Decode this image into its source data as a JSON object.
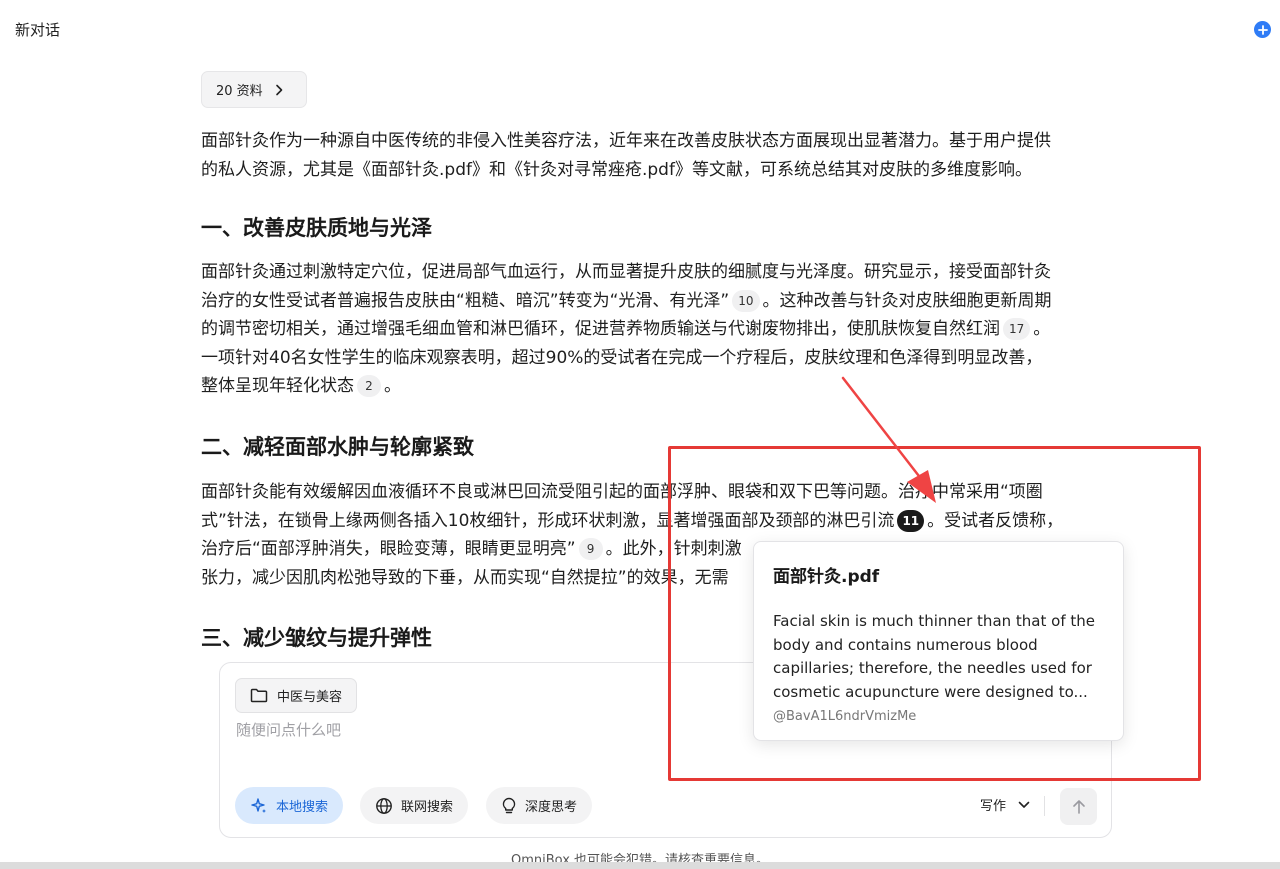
{
  "header": {
    "title": "新对话"
  },
  "sources": {
    "label": "20 资料"
  },
  "article": {
    "intro_l1": "面部针灸作为一种源自中医传统的非侵入性美容疗法，近年来在改善皮肤状态方面展现出显著潜力。基于用户提供",
    "intro_l2": "的私人资源，尤其是《面部针灸.pdf》和《针灸对寻常痤疮.pdf》等文献，可系统总结其对皮肤的多维度影响。",
    "h1": "一、改善皮肤质地与光泽",
    "p1_l1": "面部针灸通过刺激特定穴位，促进局部气血运行，从而显著提升皮肤的细腻度与光泽度。研究显示，接受面部针灸",
    "p1_l2a": "治疗的女性受试者普遍报告皮肤由“粗糙、暗沉”转变为“光滑、有光泽”",
    "p1_c1": "10",
    "p1_l2b": "。这种改善与针灸对皮肤细胞更新周期",
    "p1_l3a": "的调节密切相关，通过增强毛细血管和淋巴循环，促进营养物质输送与代谢废物排出，使肌肤恢复自然红润",
    "p1_c2": "17",
    "p1_l3b": "。",
    "p1_l4": "一项针对40名女性学生的临床观察表明，超过90%的受试者在完成一个疗程后，皮肤纹理和色泽得到明显改善，",
    "p1_l5a": "整体呈现年轻化状态",
    "p1_c3": "2",
    "p1_l5b": "。",
    "h2": "二、减轻面部水肿与轮廓紧致",
    "p2_l1": "面部针灸能有效缓解因血液循环不良或淋巴回流受阻引起的面部浮肿、眼袋和双下巴等问题。治疗中常采用“项圈",
    "p2_l2a": "式”针法，在锁骨上缘两侧各插入10枚细针，形成环状刺激，显著增强面部及颈部的淋巴引流",
    "p2_c1": "11",
    "p2_l2b": "。受试者反馈称，",
    "p2_l3a": "治疗后“面部浮肿消失，眼睑变薄，眼睛更显明亮”",
    "p2_c2": "9",
    "p2_l3b": "。此外，针刺刺激",
    "p2_l4": "张力，减少因肌肉松弛导致的下垂，从而实现“自然提拉”的效果，无需",
    "h3": "三、减少皱纹与提升弹性"
  },
  "popover": {
    "title": "面部针灸.pdf",
    "body": "Facial skin is much thinner than that of the body and contains numerous blood capillaries; therefore, the needles used for cosmetic acupuncture were designed to...",
    "source": "@BavA1L6ndrVmizMe"
  },
  "composer": {
    "kb_chip": "中医与美容",
    "placeholder": "随便问点什么吧",
    "local_search": "本地搜索",
    "web_search": "联网搜索",
    "deep_think": "深度思考",
    "mode": "写作"
  },
  "footer": {
    "disclaimer": "OmniBox 也可能会犯错。请核查重要信息。"
  },
  "colors": {
    "accent": "#2f7cf6",
    "highlight": "#e53935",
    "active_tool_bg": "#d9e9fd"
  }
}
